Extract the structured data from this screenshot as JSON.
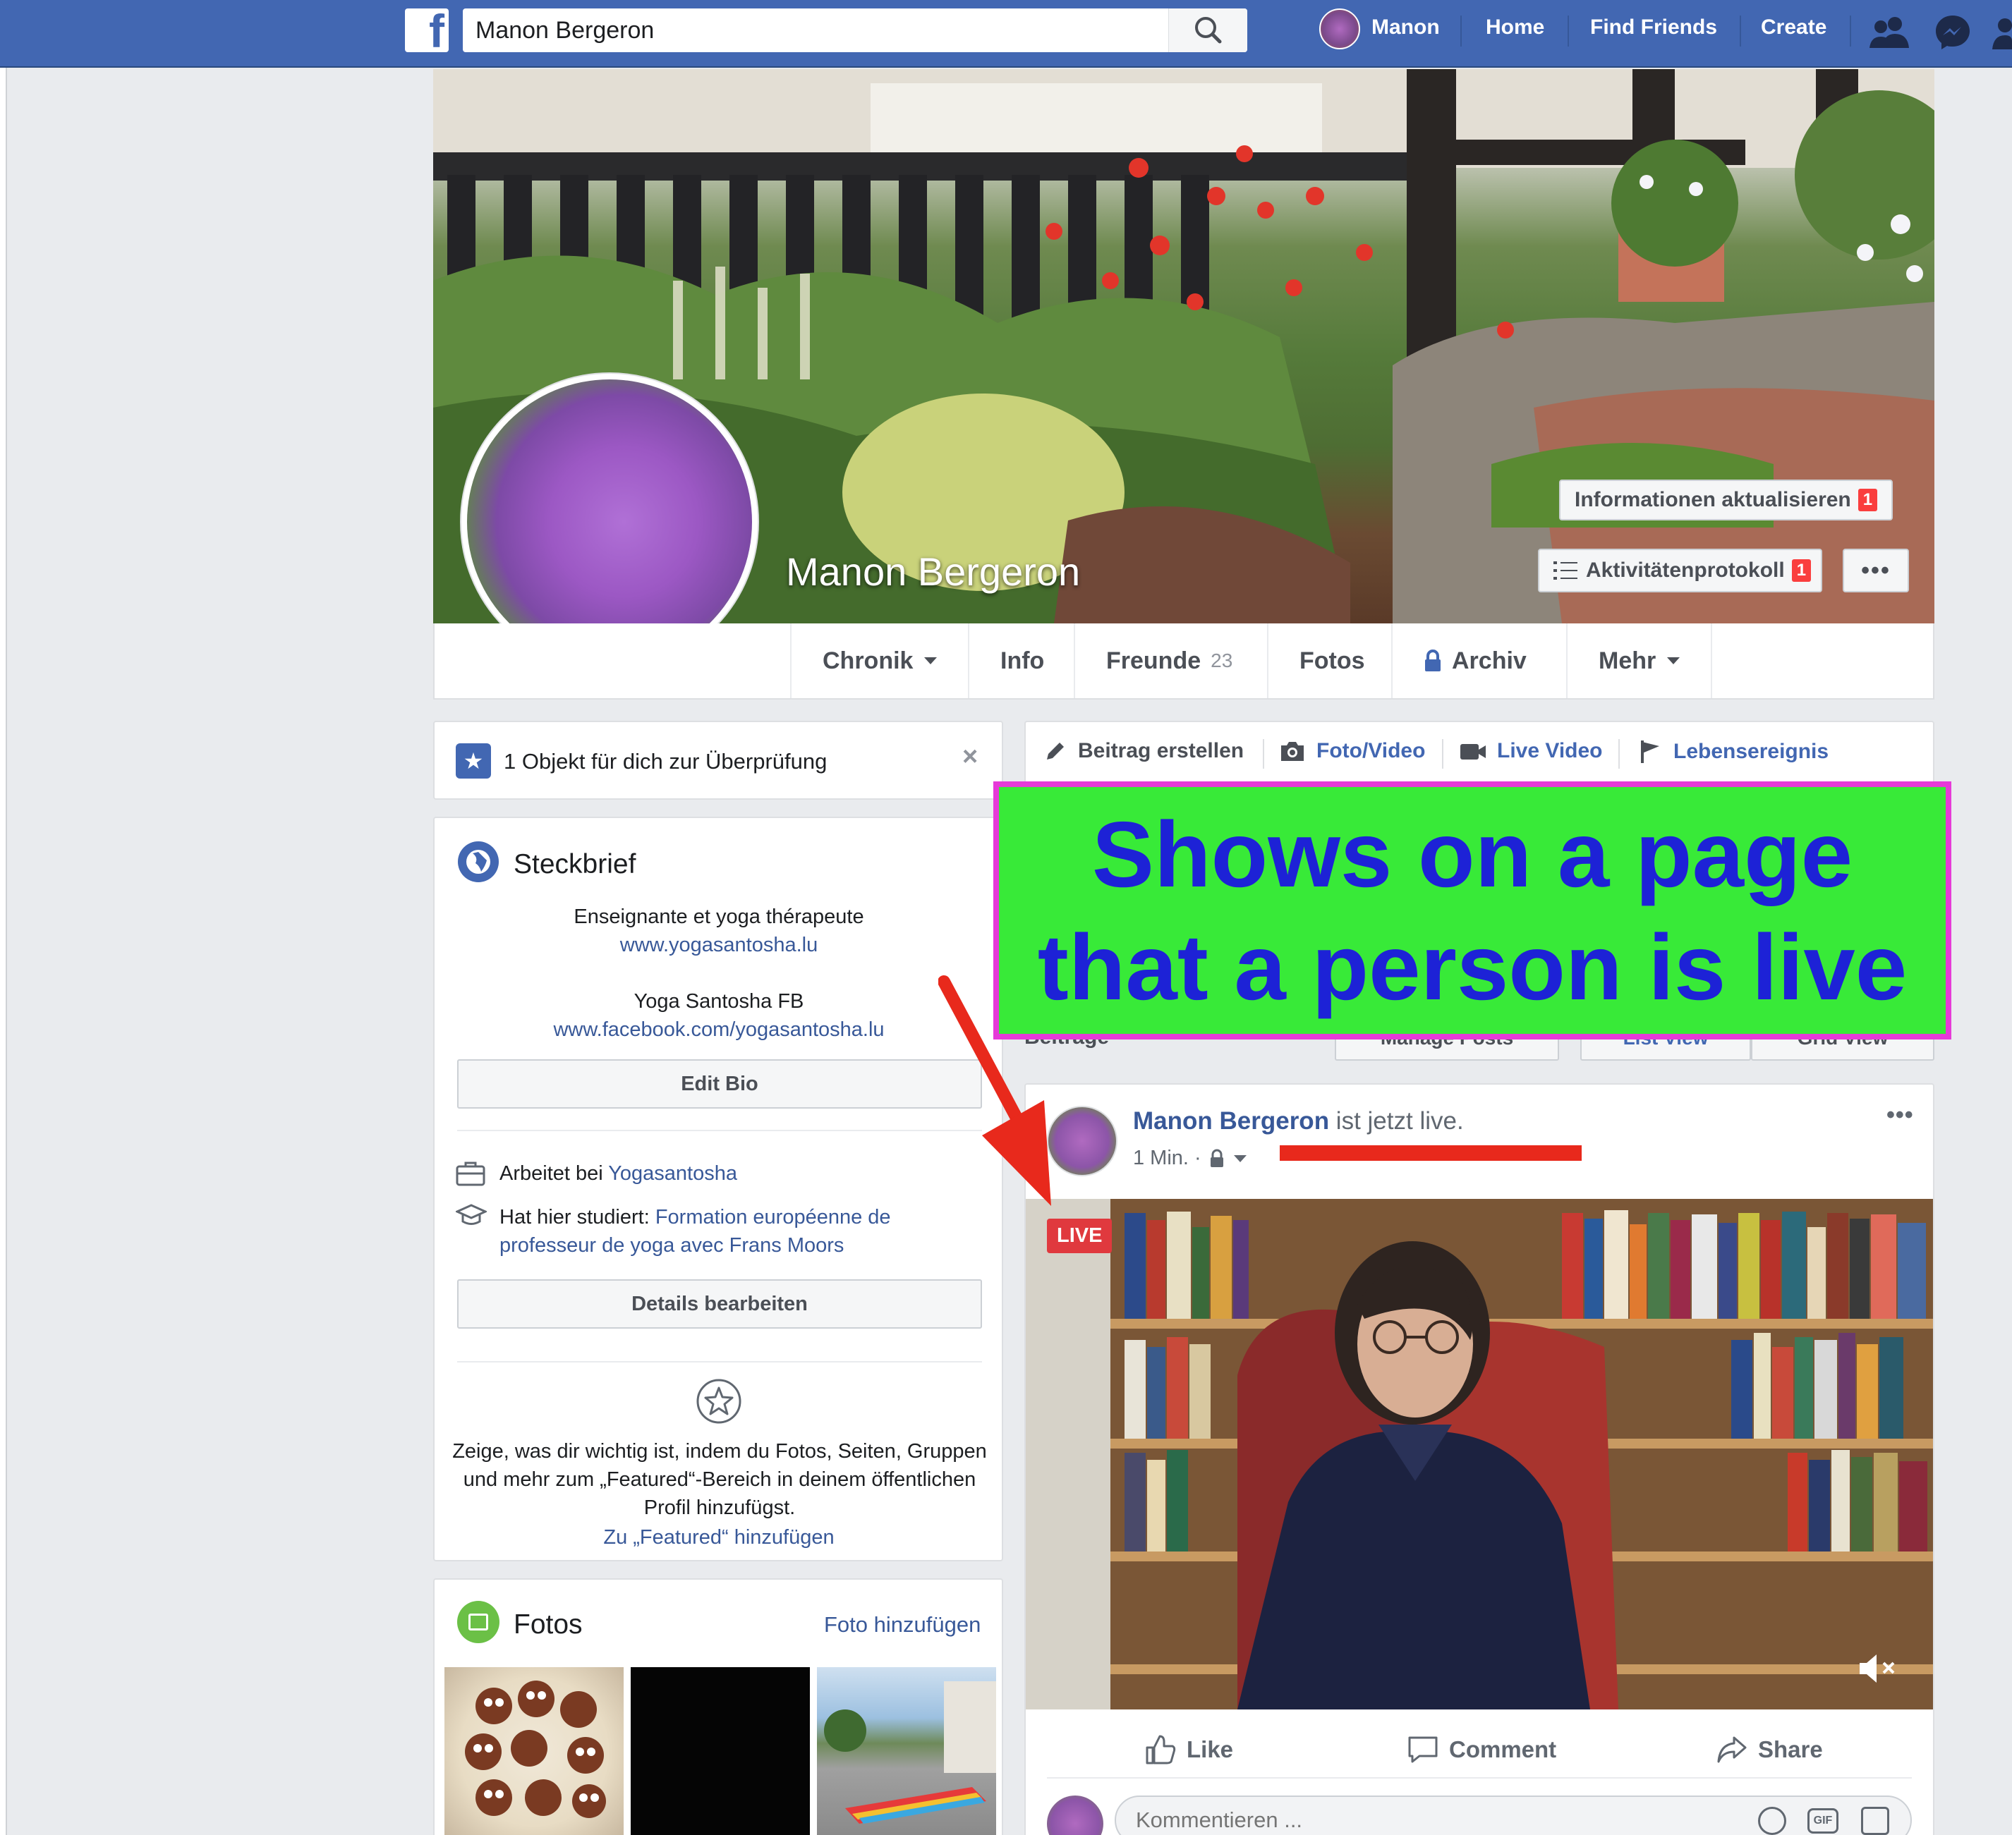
{
  "topbar": {
    "search_value": "Manon Bergeron",
    "user_name": "Manon",
    "home": "Home",
    "find_friends": "Find Friends",
    "create": "Create"
  },
  "profile": {
    "name": "Manon Bergeron",
    "update_info": "Informationen aktualisieren",
    "update_info_count": "1",
    "activity_log": "Aktivitätenprotokoll",
    "activity_log_count": "1",
    "tabs": {
      "timeline": "Chronik",
      "info": "Info",
      "friends": "Freunde",
      "friends_count": "23",
      "photos": "Fotos",
      "archive": "Archiv",
      "more": "Mehr"
    }
  },
  "review": {
    "text": "1 Objekt für dich zur Überprüfung"
  },
  "intro": {
    "title": "Steckbrief",
    "bio_line1": "Enseignante et yoga thérapeute",
    "bio_link1": "www.yogasantosha.lu",
    "bio_line2": "Yoga Santosha FB",
    "bio_link2": "www.facebook.com/yogasantosha.lu",
    "edit_bio": "Edit Bio",
    "works_prefix": "Arbeitet bei ",
    "works_link": "Yogasantosha",
    "studied_prefix": "Hat hier studiert: ",
    "studied_link": "Formation européenne de professeur de yoga avec Frans Moors",
    "edit_details": "Details bearbeiten",
    "featured_text": "Zeige, was dir wichtig ist, indem du Fotos, Seiten, Gruppen und mehr zum „Featured“-Bereich in deinem öffentlichen Profil hinzufügst.",
    "featured_link": "Zu „Featured“ hinzufügen"
  },
  "photos": {
    "title": "Fotos",
    "add": "Foto hinzufügen"
  },
  "composer": {
    "create_post": "Beitrag erstellen",
    "photo_video": "Foto/Video",
    "live_video": "Live Video",
    "life_event": "Lebensereignis"
  },
  "posts_header": {
    "title": "Beiträge",
    "manage": "Manage Posts",
    "list_view": "List View",
    "grid_view": "Grid View"
  },
  "post": {
    "author": "Manon Bergeron",
    "status": " ist jetzt live.",
    "time": "1 Min. ·",
    "live_badge": "LIVE",
    "like": "Like",
    "comment": "Comment",
    "share": "Share",
    "comment_placeholder": "Kommentieren ..."
  },
  "annotation": {
    "line1": "Shows on a page",
    "line2": "that a person is live"
  },
  "colors": {
    "fb_blue": "#4267b2",
    "link": "#385898",
    "live_red": "#e0393e",
    "callout_bg": "#38ea38",
    "callout_border": "#e63ad8",
    "callout_text": "#1d22d6",
    "arrow_red": "#e8291c"
  }
}
